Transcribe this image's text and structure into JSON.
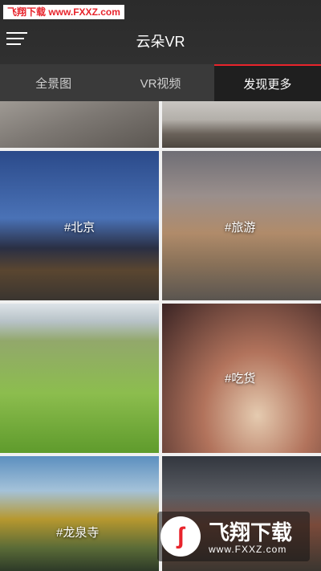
{
  "watermark_top": "飞翔下载 www.FXXZ.com",
  "header": {
    "title": "云朵VR"
  },
  "tabs": [
    {
      "label": "全景图"
    },
    {
      "label": "VR视频"
    },
    {
      "label": "发现更多"
    }
  ],
  "grid": {
    "items": [
      {
        "tag": "#北京"
      },
      {
        "tag": "#旅游"
      },
      {
        "tag": "#吃货"
      },
      {
        "tag": "#龙泉寺"
      }
    ]
  },
  "watermark_brand": {
    "logo": "ʃ",
    "name": "飞翔下载",
    "url": "www.FXXZ.com"
  },
  "colors": {
    "accent": "#e8242c",
    "header_bg": "#2d2d2d",
    "tab_bg": "#3a3a3a",
    "tab_active_bg": "#1f1f1f"
  }
}
